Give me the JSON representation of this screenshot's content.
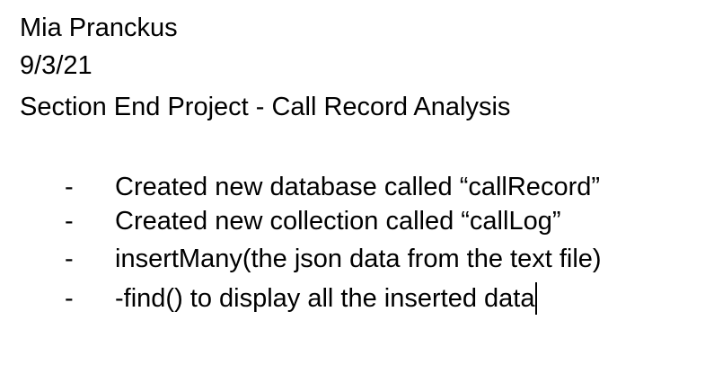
{
  "header": {
    "name": "Mia Pranckus",
    "date": "9/3/21",
    "title": "Section End Project - Call Record Analysis"
  },
  "bullets": [
    {
      "marker": "-",
      "text": "Created new database called “callRecord”"
    },
    {
      "marker": "-",
      "text": "Created new collection called “callLog”"
    },
    {
      "marker": "-",
      "text": "insertMany(the json data from the text file)"
    },
    {
      "marker": "-",
      "text": "-find() to display all the inserted data"
    }
  ]
}
